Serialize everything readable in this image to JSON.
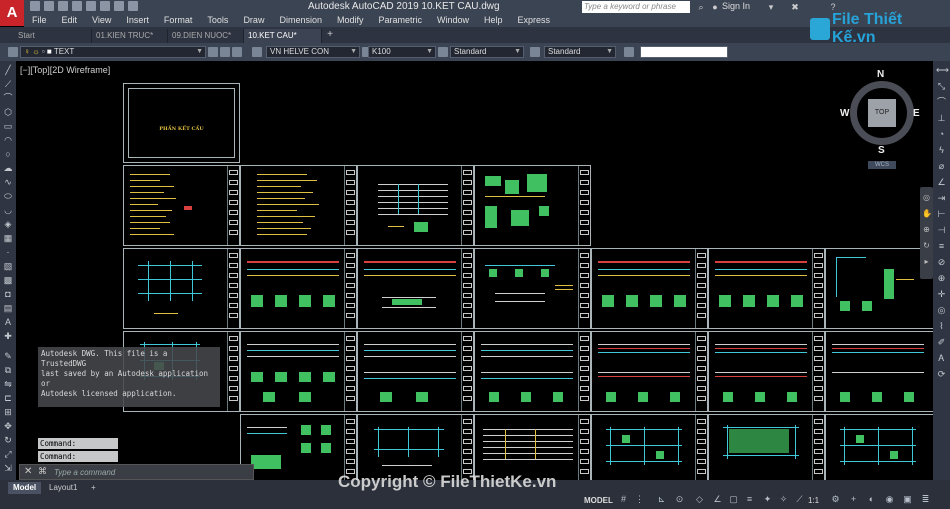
{
  "window": {
    "title": "Autodesk AutoCAD 2019    10.KET CAU.dwg",
    "app_letter": "A",
    "search_placeholder": "Type a keyword or phrase",
    "sign_in": "Sign In"
  },
  "menu": [
    "File",
    "Edit",
    "View",
    "Insert",
    "Format",
    "Tools",
    "Draw",
    "Dimension",
    "Modify",
    "Parametric",
    "Window",
    "Help",
    "Express"
  ],
  "tabs": [
    {
      "label": "Start",
      "active": false
    },
    {
      "label": "01.KIEN TRUC*",
      "active": false
    },
    {
      "label": "09.DIEN NUOC*",
      "active": false
    },
    {
      "label": "10.KET CAU*",
      "active": true
    }
  ],
  "properties": {
    "layer": "TEXT",
    "text_style": "VN HELVE CON",
    "dim_style": "K100",
    "table_style": "Standard",
    "mleader_style": "Standard",
    "extra_field": ""
  },
  "viewport_label": "[−][Top][2D Wireframe]",
  "cover_sheet_title": "PHẦN KẾT CẤU",
  "viewcube": {
    "n": "N",
    "s": "S",
    "e": "E",
    "w": "W",
    "face": "TOP",
    "wcs": "WCS"
  },
  "command": {
    "history": [
      "Autodesk DWG.  This file is a TrustedDWG",
      "last saved by an Autodesk application or",
      "Autodesk licensed application."
    ],
    "prompts": [
      "Command:",
      "Command:"
    ],
    "placeholder": "Type a command"
  },
  "layouts": [
    {
      "label": "Model",
      "active": true
    },
    {
      "label": "Layout1",
      "active": false
    }
  ],
  "status": {
    "mode": "MODEL",
    "scale": "1:1"
  },
  "watermark": {
    "brand": "File Thiết Kế.vn",
    "copyright": "Copyright © FileThietKe.vn"
  }
}
